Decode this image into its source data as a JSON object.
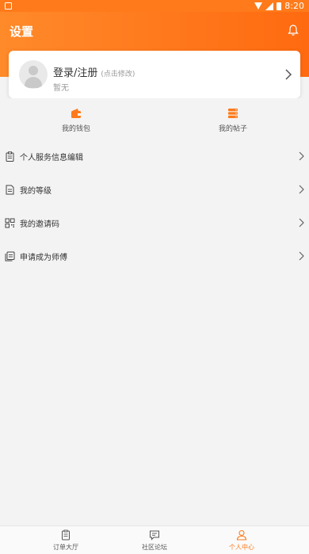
{
  "status_bar": {
    "time": "8:20"
  },
  "header": {
    "title": "设置"
  },
  "profile": {
    "name": "登录/注册",
    "hint": "(点击修改)",
    "subtitle": "暂无"
  },
  "shortcuts": [
    {
      "label": "我的钱包",
      "icon": "wallet-icon"
    },
    {
      "label": "我的帖子",
      "icon": "posts-icon"
    }
  ],
  "menu": [
    {
      "label": "个人服务信息编辑",
      "icon": "clipboard-icon"
    },
    {
      "label": "我的等级",
      "icon": "document-icon"
    },
    {
      "label": "我的邀请码",
      "icon": "qr-code-icon"
    },
    {
      "label": "申请成为师傅",
      "icon": "files-icon"
    }
  ],
  "tabs": [
    {
      "label": "订单大厅",
      "icon": "order-icon",
      "active": false
    },
    {
      "label": "社区论坛",
      "icon": "chat-icon",
      "active": false
    },
    {
      "label": "个人中心",
      "icon": "person-icon",
      "active": true
    }
  ],
  "colors": {
    "accent": "#ff7a1a"
  }
}
